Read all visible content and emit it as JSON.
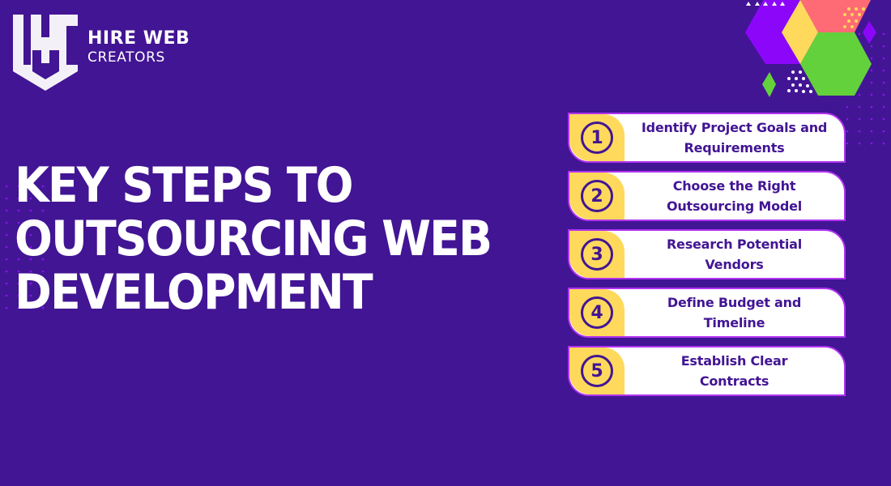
{
  "brand": {
    "logo_icon": "hwc-shield-monogram",
    "name_line1": "HIRE WEB",
    "name_line2": "CREATORS"
  },
  "headline": {
    "lines": [
      "KEY STEPS TO",
      "OUTSOURCING WEB",
      "DEVELOPMENT"
    ]
  },
  "steps": [
    {
      "number": "1",
      "line1": "Identify Project Goals and",
      "line2": "Requirements"
    },
    {
      "number": "2",
      "line1": "Choose the Right",
      "line2": "Outsourcing Model"
    },
    {
      "number": "3",
      "line1": "Research Potential",
      "line2": "Vendors"
    },
    {
      "number": "4",
      "line1": "Define Budget and",
      "line2": "Timeline"
    },
    {
      "number": "5",
      "line1": "Establish Clear",
      "line2": "Contracts"
    }
  ],
  "colors": {
    "background": "#421594",
    "accent_yellow": "#ffd95c",
    "card_border": "#b133f0",
    "hex_purple": "#8c07fa",
    "hex_coral": "#fe6b74",
    "hex_green": "#63d13b",
    "dot_purple": "#8a16f0",
    "text_dark": "#421594",
    "text_light": "#ffffff"
  }
}
